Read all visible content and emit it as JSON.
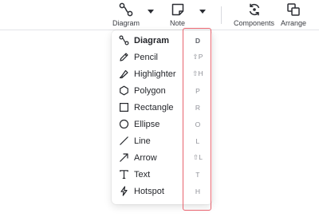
{
  "toolbar": {
    "diagram_label": "Diagram",
    "note_label": "Note",
    "components_label": "Components",
    "arrange_label": "Arrange"
  },
  "menu": {
    "items": [
      {
        "label": "Diagram",
        "shortcut": "D",
        "icon": "diagram-icon",
        "active": true
      },
      {
        "label": "Pencil",
        "shortcut": "⇧P",
        "icon": "pencil-icon"
      },
      {
        "label": "Highlighter",
        "shortcut": "⇧H",
        "icon": "highlighter-icon"
      },
      {
        "label": "Polygon",
        "shortcut": "P",
        "icon": "polygon-icon"
      },
      {
        "label": "Rectangle",
        "shortcut": "R",
        "icon": "rectangle-icon"
      },
      {
        "label": "Ellipse",
        "shortcut": "O",
        "icon": "ellipse-icon"
      },
      {
        "label": "Line",
        "shortcut": "L",
        "icon": "line-icon"
      },
      {
        "label": "Arrow",
        "shortcut": "⇧L",
        "icon": "arrow-icon"
      },
      {
        "label": "Text",
        "shortcut": "T",
        "icon": "text-icon"
      },
      {
        "label": "Hotspot",
        "shortcut": "H",
        "icon": "hotspot-icon"
      }
    ]
  },
  "colors": {
    "highlight_border": "#e8636e",
    "shortcut_text": "#8e9097"
  }
}
